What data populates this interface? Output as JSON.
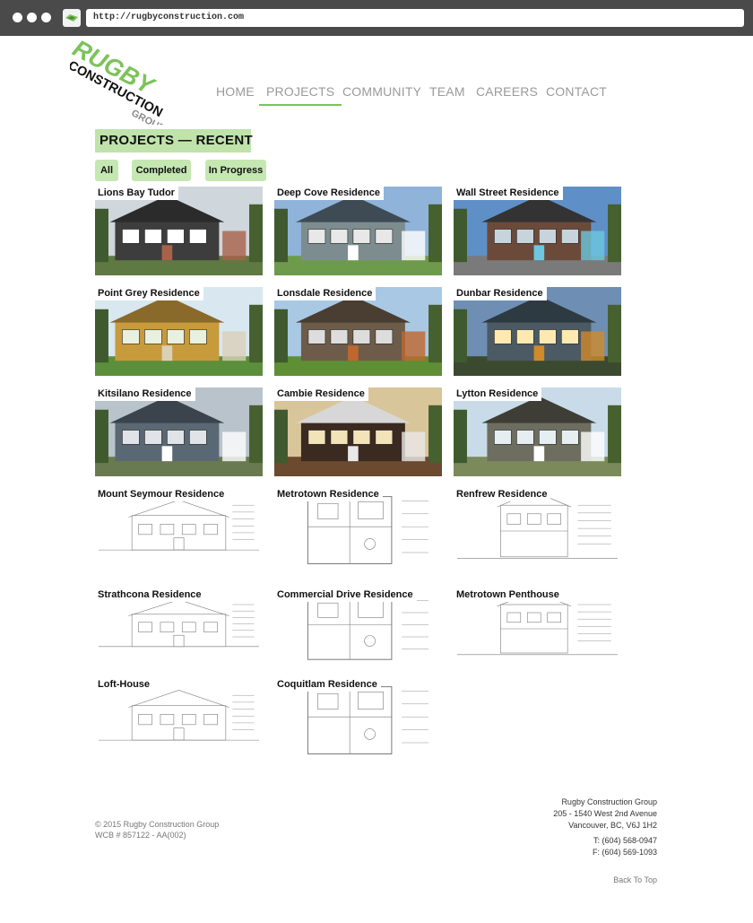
{
  "browser": {
    "url": "http://rugbyconstruction.com"
  },
  "logo": {
    "line1": "RUGBY",
    "line2": "CONSTRUCTION",
    "line3": "GROUP"
  },
  "nav": {
    "items": [
      {
        "label": "HOME"
      },
      {
        "label": "PROJECTS",
        "active": true
      },
      {
        "label": "COMMUNITY"
      },
      {
        "label": "TEAM"
      },
      {
        "label": "CAREERS"
      },
      {
        "label": "CONTACT"
      }
    ]
  },
  "heading": "PROJECTS —   RECENT",
  "filters": [
    {
      "label": "All"
    },
    {
      "label": "Completed"
    },
    {
      "label": "In Progress"
    }
  ],
  "projects": [
    {
      "name": "Lions Bay Tudor",
      "kind": "photo"
    },
    {
      "name": "Deep Cove Residence",
      "kind": "photo"
    },
    {
      "name": "Wall Street Residence",
      "kind": "photo"
    },
    {
      "name": "Point Grey Residence",
      "kind": "photo"
    },
    {
      "name": "Lonsdale Residence",
      "kind": "photo"
    },
    {
      "name": "Dunbar Residence",
      "kind": "photo"
    },
    {
      "name": "Kitsilano Residence",
      "kind": "photo"
    },
    {
      "name": "Cambie Residence",
      "kind": "photo"
    },
    {
      "name": "Lytton Residence",
      "kind": "photo"
    },
    {
      "name": "Mount Seymour Residence",
      "kind": "drawing"
    },
    {
      "name": "Metrotown Residence",
      "kind": "drawing"
    },
    {
      "name": "Renfrew Residence",
      "kind": "drawing"
    },
    {
      "name": "Strathcona Residence",
      "kind": "drawing"
    },
    {
      "name": "Commercial Drive Residence",
      "kind": "drawing"
    },
    {
      "name": "Metrotown Penthouse",
      "kind": "drawing"
    },
    {
      "name": "Loft-House",
      "kind": "drawing"
    },
    {
      "name": "Coquitlam Residence",
      "kind": "drawing"
    }
  ],
  "footer": {
    "copyright": "© 2015 Rugby Construction Group",
    "wcb": "WCB # 857122 - AA(002)",
    "company": "Rugby Construction Group",
    "address1": "205 - 1540 West 2nd Avenue",
    "address2": "Vancouver, BC, V6J 1H2",
    "phone": "T: (604) 568-0947",
    "fax": "F: (604) 569-1093",
    "back_to_top": "Back To Top"
  },
  "colors": {
    "accent": "#7cc35a",
    "heading_bg": "#bfe3ab",
    "nav": "#9a9a9a"
  }
}
